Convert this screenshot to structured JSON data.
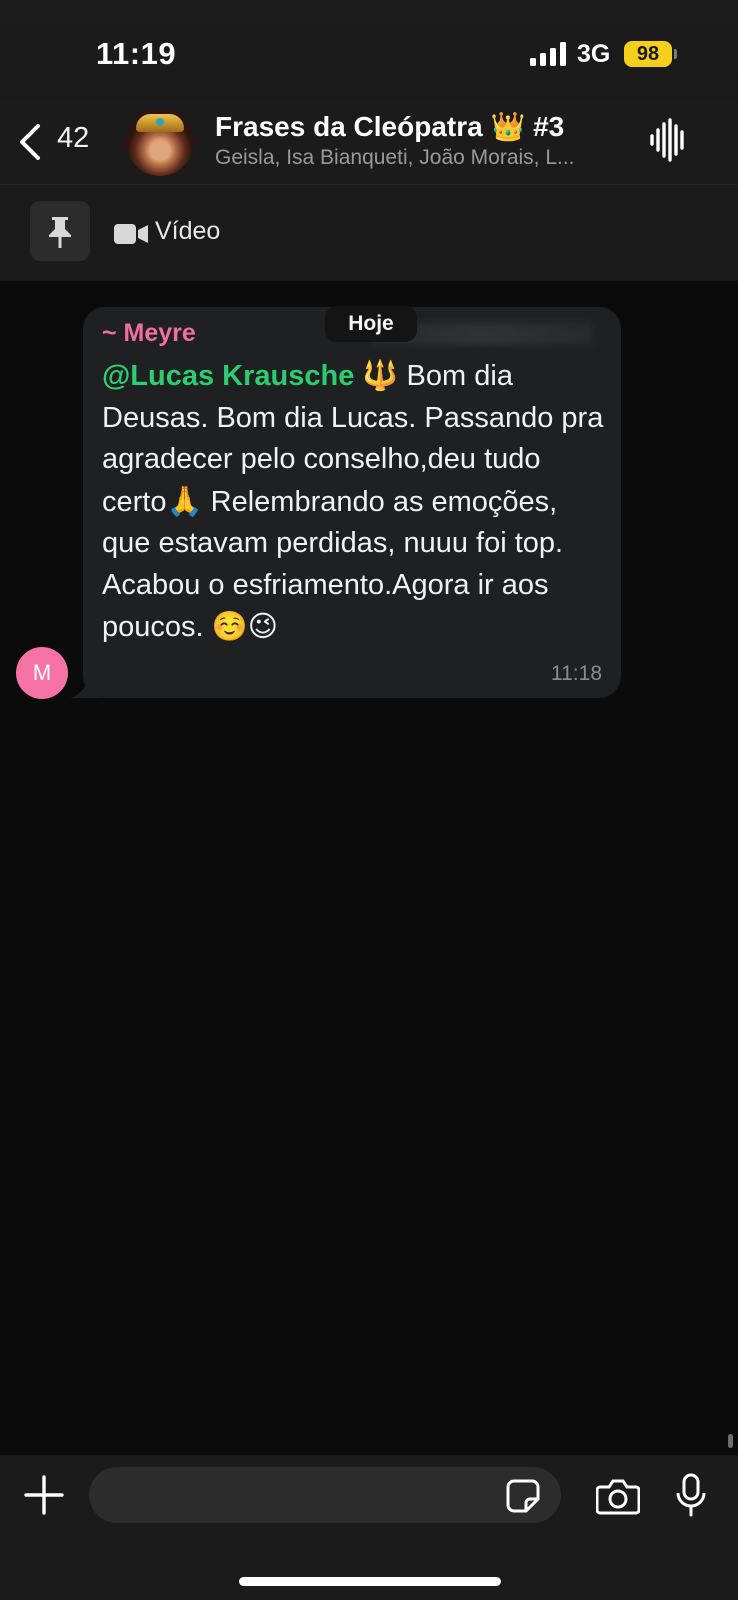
{
  "status_bar": {
    "time": "11:19",
    "network": "3G",
    "battery": "98",
    "battery_color": "#f5cf1b"
  },
  "header": {
    "back_count": "42",
    "title": "Frases da Cleópatra 👑 #3",
    "members": "Geisla, Isa Bianqueti, João Morais, L..."
  },
  "pinned": {
    "label": "Vídeo"
  },
  "date_chip": "Hoje",
  "message": {
    "sender": "~ Meyre",
    "sender_initial": "M",
    "sender_color": "#f26f9b",
    "mention": "@Lucas Krausche",
    "mention_color": "#2ecc71",
    "emoji_after_mention": "🔱",
    "text_part1": " Bom dia Deusas. Bom dia Lucas. Passando pra agradecer pelo conselho,deu tudo certo",
    "emoji_pray": "🙏",
    "text_part2": "Relembrando as emoções, que estavam perdidas, nuuu foi top. Acabou o esfriamento.Agora ir aos poucos. ",
    "emoji_end": "☺️😉",
    "time": "11:18"
  },
  "input": {
    "placeholder": ""
  },
  "icons": {
    "back": "chevron-left-icon",
    "voice": "audio-waveform-icon",
    "pin": "pin-icon",
    "video": "video-camera-icon",
    "plus": "plus-icon",
    "sticker": "sticker-icon",
    "camera": "camera-icon",
    "mic": "microphone-icon"
  }
}
